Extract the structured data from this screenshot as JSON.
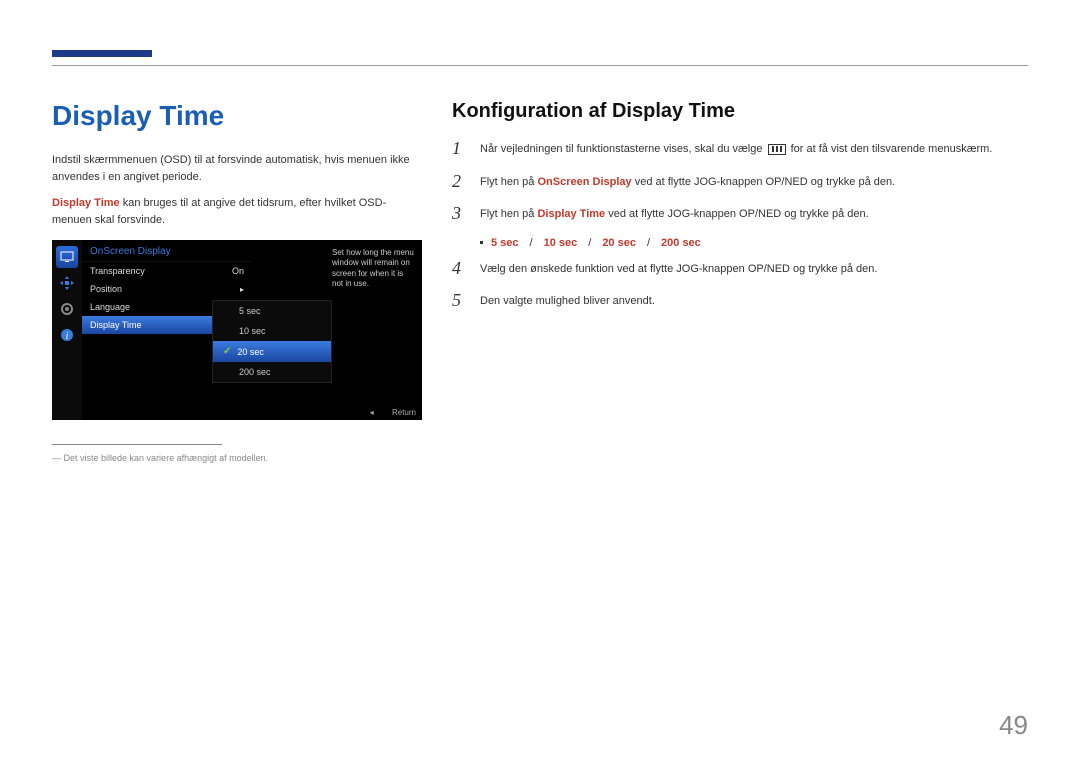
{
  "page_number": "49",
  "left": {
    "heading": "Display Time",
    "para1": "Indstil skærmmenuen (OSD) til at forsvinde automatisk, hvis menuen ikke anvendes i en angivet periode.",
    "para2_prefix": "Display Time",
    "para2_rest": " kan bruges til at angive det tidsrum, efter hvilket OSD-menuen skal forsvinde.",
    "footnote_dash": "―",
    "footnote": "Det viste billede kan variere afhængigt af modellen."
  },
  "osd": {
    "title": "OnScreen Display",
    "rows": {
      "transparency": {
        "label": "Transparency",
        "value": "On"
      },
      "position": {
        "label": "Position",
        "value": "▸"
      },
      "language": {
        "label": "Language",
        "value": ""
      },
      "display_time": {
        "label": "Display Time",
        "value": ""
      }
    },
    "options": {
      "o1": "5 sec",
      "o2": "10 sec",
      "o3": "20 sec",
      "o4": "200 sec"
    },
    "help": "Set how long the menu window will remain on screen for when it is not in use.",
    "footer_arrow": "◂",
    "footer_return": "Return"
  },
  "right": {
    "heading": "Konfiguration af Display Time",
    "steps": {
      "s1": {
        "num": "1",
        "pre": "Når vejledningen til funktionstasterne vises, skal du vælge ",
        "post": " for at få vist den tilsvarende menuskærm."
      },
      "s2": {
        "num": "2",
        "pre": "Flyt hen på ",
        "emph": "OnScreen Display",
        "post": " ved at flytte JOG-knappen OP/NED og trykke på den."
      },
      "s3": {
        "num": "3",
        "pre": "Flyt hen på ",
        "emph": "Display Time",
        "post": " ved at flytte JOG-knappen OP/NED og trykke på den."
      },
      "s4": {
        "num": "4",
        "text": "Vælg den ønskede funktion ved at flytte JOG-knappen OP/NED og trykke på den."
      },
      "s5": {
        "num": "5",
        "text": "Den valgte mulighed bliver anvendt."
      }
    },
    "options": {
      "a": "5 sec",
      "b": "10 sec",
      "c": "20 sec",
      "d": "200 sec",
      "sep": "/"
    }
  }
}
